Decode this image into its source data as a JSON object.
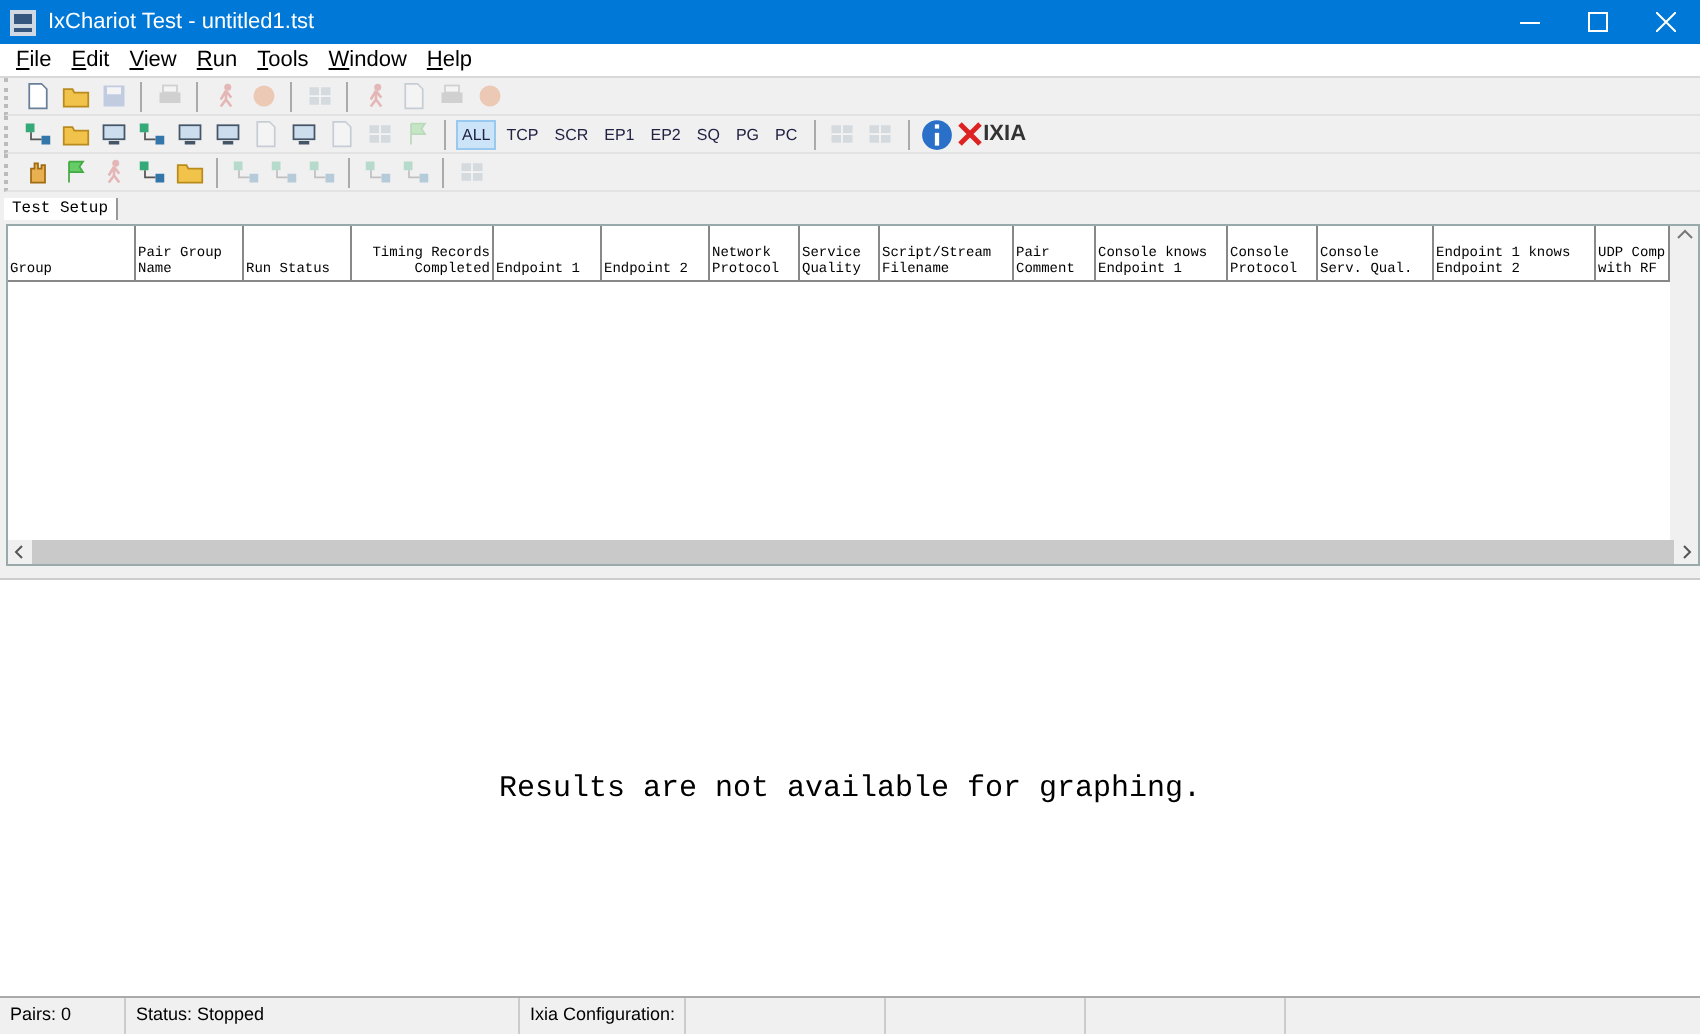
{
  "window": {
    "title": "IxChariot Test - untitled1.tst"
  },
  "menu": [
    "File",
    "Edit",
    "View",
    "Run",
    "Tools",
    "Window",
    "Help"
  ],
  "toolbars": [
    {
      "items": [
        {
          "kind": "button",
          "disabled": false
        },
        {
          "kind": "button",
          "disabled": false
        },
        {
          "kind": "button",
          "disabled": true
        },
        {
          "kind": "separator"
        },
        {
          "kind": "button",
          "disabled": true
        },
        {
          "kind": "separator"
        },
        {
          "kind": "button",
          "disabled": true
        },
        {
          "kind": "button",
          "disabled": true
        },
        {
          "kind": "separator"
        },
        {
          "kind": "button",
          "disabled": true
        },
        {
          "kind": "separator"
        },
        {
          "kind": "button",
          "disabled": true
        },
        {
          "kind": "button",
          "disabled": true
        },
        {
          "kind": "button",
          "disabled": true
        },
        {
          "kind": "button",
          "disabled": true
        }
      ]
    },
    {
      "items": [
        {
          "kind": "button",
          "disabled": false
        },
        {
          "kind": "button",
          "disabled": false
        },
        {
          "kind": "button",
          "disabled": false
        },
        {
          "kind": "button",
          "disabled": false
        },
        {
          "kind": "button",
          "disabled": false
        },
        {
          "kind": "button",
          "disabled": false
        },
        {
          "kind": "button",
          "disabled": true
        },
        {
          "kind": "button",
          "disabled": false
        },
        {
          "kind": "button",
          "disabled": true
        },
        {
          "kind": "button",
          "disabled": true
        },
        {
          "kind": "button",
          "disabled": true
        },
        {
          "kind": "separator"
        },
        {
          "kind": "text",
          "label": "ALL",
          "selected": true
        },
        {
          "kind": "text",
          "label": "TCP",
          "selected": false
        },
        {
          "kind": "text",
          "label": "SCR",
          "selected": false
        },
        {
          "kind": "text",
          "label": "EP1",
          "selected": false
        },
        {
          "kind": "text",
          "label": "EP2",
          "selected": false
        },
        {
          "kind": "text",
          "label": "SQ",
          "selected": false
        },
        {
          "kind": "text",
          "label": "PG",
          "selected": false
        },
        {
          "kind": "text",
          "label": "PC",
          "selected": false
        },
        {
          "kind": "separator"
        },
        {
          "kind": "button",
          "disabled": true
        },
        {
          "kind": "button",
          "disabled": true
        },
        {
          "kind": "separator"
        },
        {
          "kind": "info"
        },
        {
          "kind": "logo",
          "label": "IXIA"
        }
      ]
    },
    {
      "items": [
        {
          "kind": "button",
          "disabled": false
        },
        {
          "kind": "button",
          "disabled": false
        },
        {
          "kind": "button",
          "disabled": true
        },
        {
          "kind": "button",
          "disabled": false
        },
        {
          "kind": "button",
          "disabled": false
        },
        {
          "kind": "separator"
        },
        {
          "kind": "button",
          "disabled": true
        },
        {
          "kind": "button",
          "disabled": true
        },
        {
          "kind": "button",
          "disabled": true
        },
        {
          "kind": "separator"
        },
        {
          "kind": "button",
          "disabled": true
        },
        {
          "kind": "button",
          "disabled": true
        },
        {
          "kind": "separator"
        },
        {
          "kind": "button",
          "disabled": true
        }
      ]
    }
  ],
  "tabs": [
    {
      "label": "Test Setup",
      "selected": true
    }
  ],
  "table": {
    "columns": [
      {
        "label": "Group"
      },
      {
        "label": "Pair Group\nName"
      },
      {
        "label": "Run Status"
      },
      {
        "label": "Timing Records\nCompleted"
      },
      {
        "label": "Endpoint 1"
      },
      {
        "label": "Endpoint 2"
      },
      {
        "label": "Network\nProtocol"
      },
      {
        "label": "Service\nQuality"
      },
      {
        "label": "Script/Stream\nFilename"
      },
      {
        "label": "Pair\nComment"
      },
      {
        "label": "Console knows\nEndpoint 1"
      },
      {
        "label": "Console\nProtocol"
      },
      {
        "label": "Console\nServ. Qual."
      },
      {
        "label": "Endpoint 1 knows\nEndpoint 2"
      },
      {
        "label": "UDP Comp\nwith RF"
      }
    ]
  },
  "graph": {
    "message": "Results are not available for graphing."
  },
  "status_bar": [
    "Pairs: 0",
    "Status: Stopped",
    "Ixia Configuration:"
  ]
}
